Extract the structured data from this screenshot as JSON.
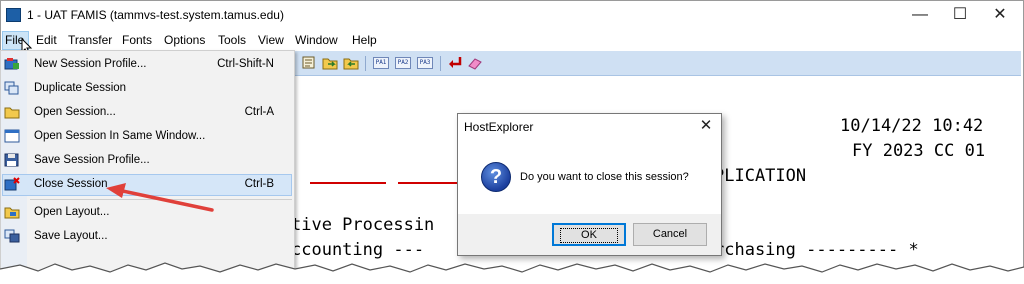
{
  "window": {
    "title": "1 - UAT FAMIS (tammvs-test.system.tamus.edu)",
    "minimize": "—",
    "maximize": "☐",
    "close": "✕"
  },
  "menubar": [
    "File",
    "Edit",
    "Transfer",
    "Fonts",
    "Options",
    "Tools",
    "View",
    "Window",
    "Help"
  ],
  "toolbar": {
    "pf_keys": [
      "PA1",
      "PA2",
      "PA3"
    ]
  },
  "terminal": {
    "datetime": "10/14/22 10:42",
    "fy_line": "FY 2023 CC 01",
    "app_line": "PLICATION",
    "processing": "tive Processin",
    "accounting": "ccounting ---",
    "purchasing": "rchasing --------- *"
  },
  "file_menu": {
    "items": [
      {
        "label": "New Session Profile...",
        "shortcut": "Ctrl-Shift-N",
        "icon": "new-session-icon"
      },
      {
        "label": "Duplicate Session",
        "shortcut": "",
        "icon": "duplicate-session-icon"
      },
      {
        "label": "Open Session...",
        "shortcut": "Ctrl-A",
        "icon": "open-folder-icon"
      },
      {
        "label": "Open Session In Same Window...",
        "shortcut": "",
        "icon": "window-icon"
      },
      {
        "label": "Save Session Profile...",
        "shortcut": "",
        "icon": "save-icon"
      },
      {
        "label": "Close Session",
        "shortcut": "Ctrl-B",
        "icon": "close-session-icon"
      },
      {
        "label": "Open Layout...",
        "shortcut": "",
        "icon": "open-layout-icon"
      },
      {
        "label": "Save Layout...",
        "shortcut": "",
        "icon": "save-layout-icon"
      }
    ]
  },
  "dialog": {
    "title": "HostExplorer",
    "close": "✕",
    "icon": "question-icon",
    "message": "Do you want to close this session?",
    "ok_label": "OK",
    "cancel_label": "Cancel"
  },
  "colors": {
    "accent": "#0078d7",
    "toolbar": "#cfe0f3",
    "menu_highlight": "#d5e6f8",
    "annotation_arrow": "#e0403a",
    "terminal_red": "#d00000"
  }
}
